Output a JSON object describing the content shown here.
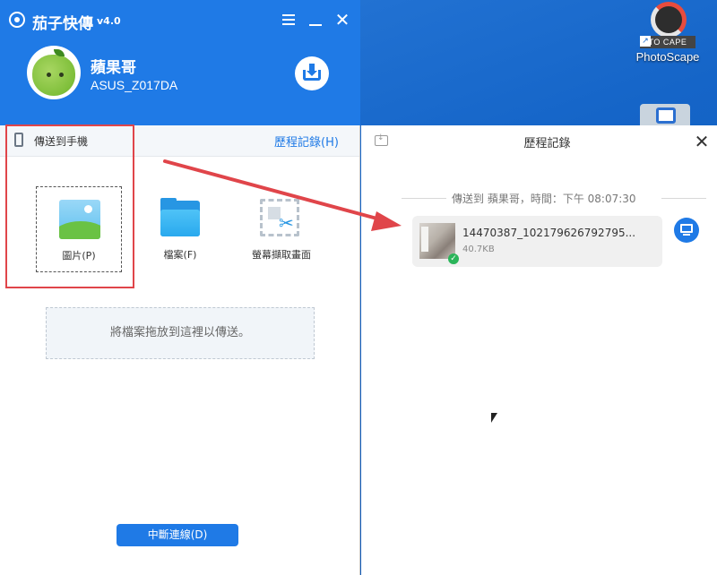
{
  "app": {
    "title": "茄子快傳",
    "version": "v4.0",
    "user_name": "蘋果哥",
    "device_name": "ASUS_Z017DA"
  },
  "desktop": {
    "icon_label": "PhotoScape",
    "icon_banner": "TO CAPE"
  },
  "sendbar": {
    "label": "傳送到手機",
    "history_link": "歷程記錄(H)"
  },
  "file_types": [
    {
      "label": "圖片(P)",
      "icon": "picture-icon"
    },
    {
      "label": "檔案(F)",
      "icon": "folder-icon"
    },
    {
      "label": "螢幕擷取畫面",
      "icon": "screenshot-icon"
    }
  ],
  "dropzone": {
    "text": "將檔案拖放到這裡以傳送。"
  },
  "disconnect_label": "中斷連線(D)",
  "history": {
    "title": "歷程記錄",
    "time_line": "傳送到 蘋果哥，時間：下午 08:07:30",
    "file_name": "14470387_102179626792795...",
    "file_size": "40.7KB"
  },
  "colors": {
    "brand_blue": "#1f7ae6",
    "highlight_red": "#e0454a"
  }
}
